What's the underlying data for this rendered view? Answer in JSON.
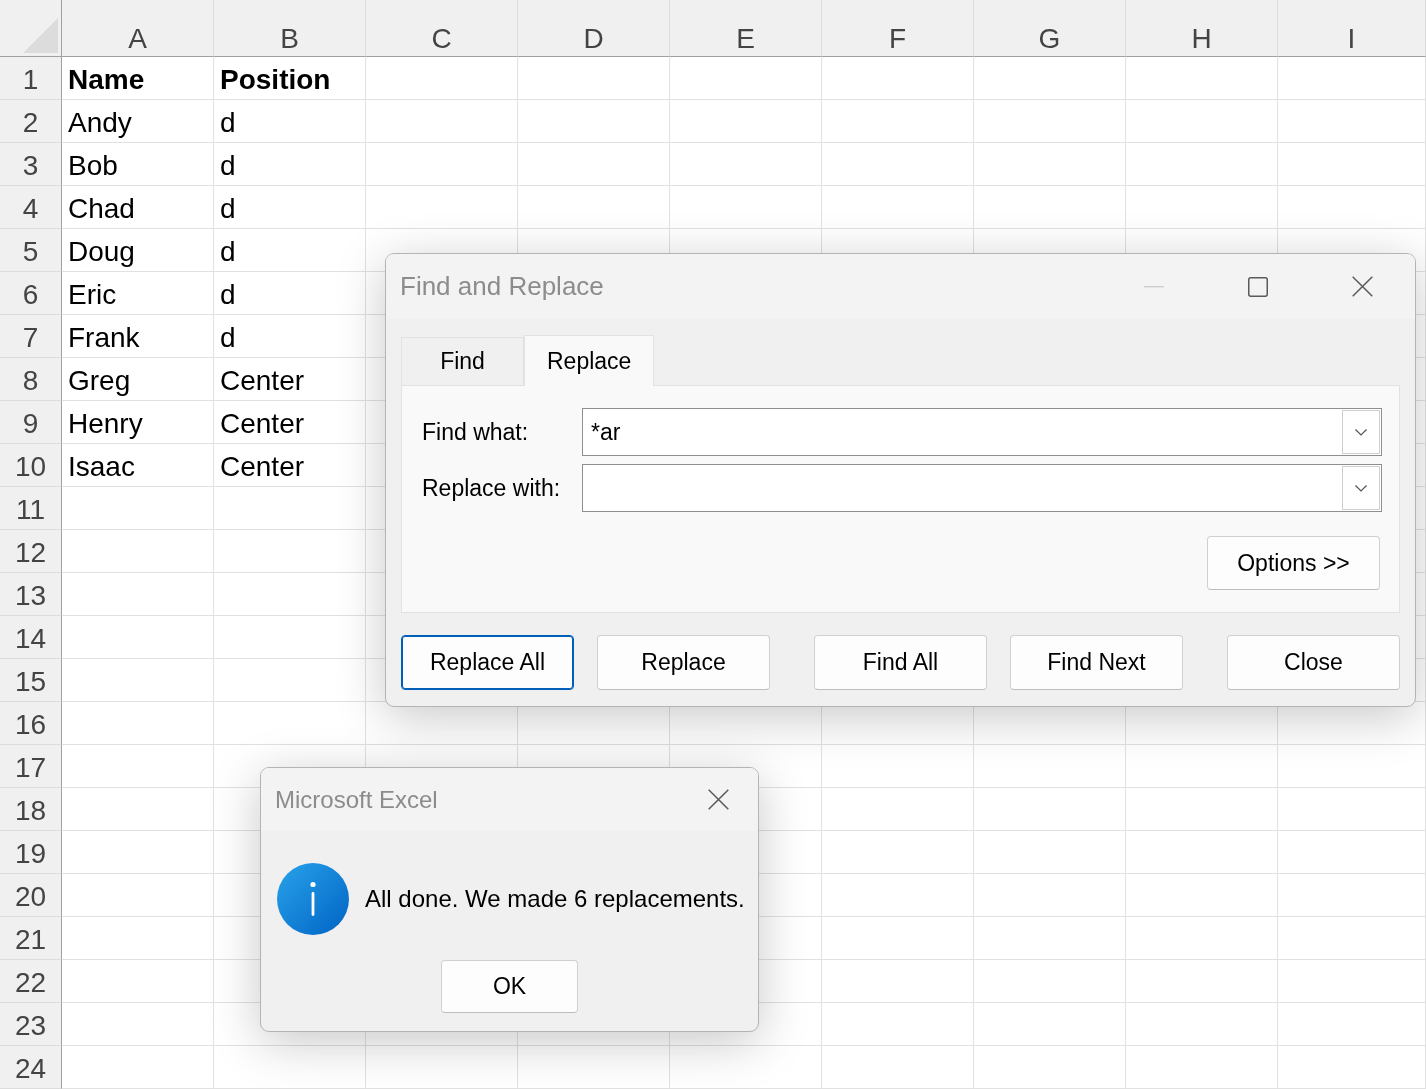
{
  "spreadsheet": {
    "columns": [
      "A",
      "B",
      "C",
      "D",
      "E",
      "F",
      "G",
      "H",
      "I"
    ],
    "rows": [
      {
        "number": "1",
        "bold": true,
        "cells": [
          "Name",
          "Position"
        ]
      },
      {
        "number": "2",
        "bold": false,
        "cells": [
          "Andy",
          "d"
        ]
      },
      {
        "number": "3",
        "bold": false,
        "cells": [
          "Bob",
          "d"
        ]
      },
      {
        "number": "4",
        "bold": false,
        "cells": [
          "Chad",
          "d"
        ]
      },
      {
        "number": "5",
        "bold": false,
        "cells": [
          "Doug",
          "d"
        ]
      },
      {
        "number": "6",
        "bold": false,
        "cells": [
          "Eric",
          "d"
        ]
      },
      {
        "number": "7",
        "bold": false,
        "cells": [
          "Frank",
          "d"
        ]
      },
      {
        "number": "8",
        "bold": false,
        "cells": [
          "Greg",
          "Center"
        ]
      },
      {
        "number": "9",
        "bold": false,
        "cells": [
          "Henry",
          "Center"
        ]
      },
      {
        "number": "10",
        "bold": false,
        "cells": [
          "Isaac",
          "Center"
        ]
      },
      {
        "number": "11"
      },
      {
        "number": "12"
      },
      {
        "number": "13"
      },
      {
        "number": "14"
      },
      {
        "number": "15"
      },
      {
        "number": "16"
      },
      {
        "number": "17"
      },
      {
        "number": "18"
      },
      {
        "number": "19"
      },
      {
        "number": "20"
      },
      {
        "number": "21"
      },
      {
        "number": "22"
      },
      {
        "number": "23"
      },
      {
        "number": "24"
      }
    ]
  },
  "find_replace_dialog": {
    "title": "Find and Replace",
    "window_controls": [
      {
        "kind": "minimize",
        "disabled": true
      },
      {
        "kind": "maximize",
        "disabled": false
      },
      {
        "kind": "close",
        "disabled": false
      }
    ],
    "tabs": [
      {
        "label": "Find",
        "selected": false
      },
      {
        "label": "Replace",
        "selected": true
      }
    ],
    "fields": [
      {
        "label": "Find what:",
        "value": "*ar"
      },
      {
        "label": "Replace with:"
      }
    ],
    "options_button": {
      "label": "Options >>"
    },
    "button_groups": [
      {
        "buttons": [
          {
            "label": "Replace All",
            "default": true
          },
          {
            "label": "Replace",
            "default": false
          }
        ]
      },
      {
        "buttons": [
          {
            "label": "Find All",
            "default": false
          },
          {
            "label": "Find Next",
            "default": false
          }
        ]
      },
      {
        "buttons": [
          {
            "label": "Close",
            "default": false
          }
        ]
      }
    ]
  },
  "message_box": {
    "title": "Microsoft Excel",
    "window_controls": [
      {
        "kind": "close",
        "disabled": false
      }
    ],
    "message": "All done. We made 6 replacements.",
    "buttons": [
      {
        "label": "OK",
        "default": false
      }
    ]
  }
}
